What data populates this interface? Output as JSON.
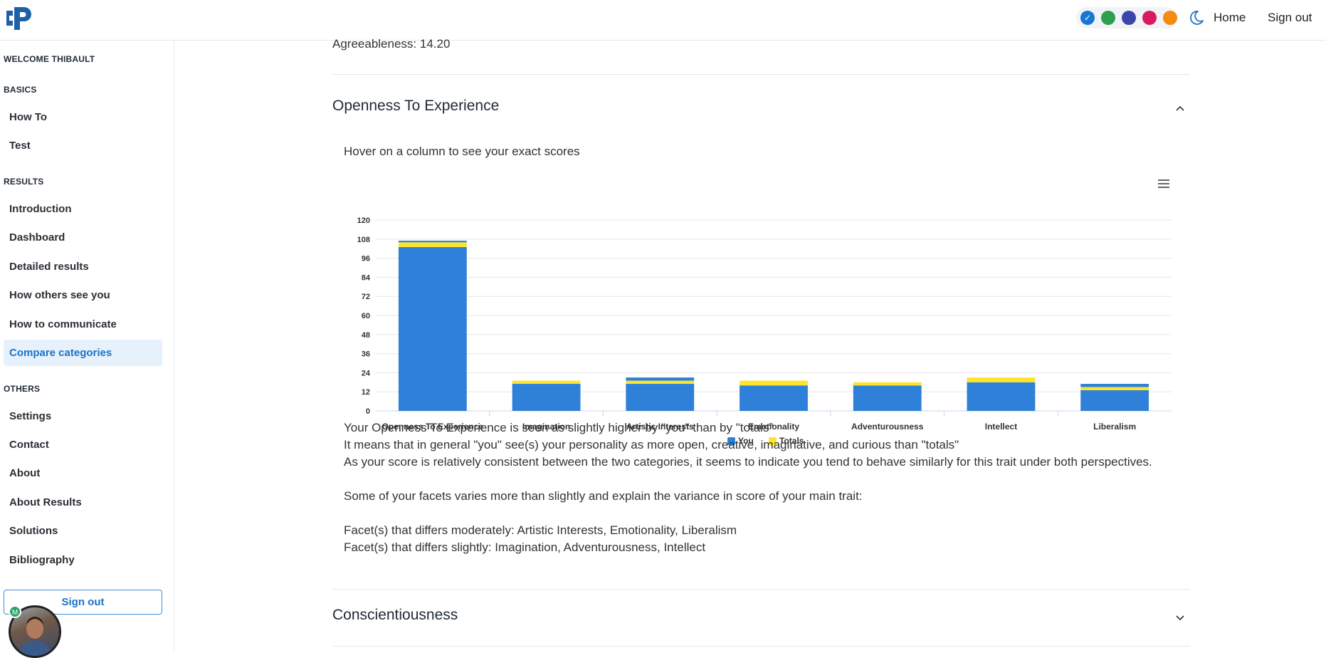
{
  "nav": {
    "home": "Home",
    "signout": "Sign out",
    "theme_colors": [
      "#1976d2",
      "#2e9e4f",
      "#3a46a8",
      "#d81b60",
      "#f58a12"
    ]
  },
  "sidebar": {
    "welcome": "WELCOME THIBAULT",
    "basics_header": "BASICS",
    "basics": [
      "How To",
      "Test"
    ],
    "results_header": "RESULTS",
    "results": [
      "Introduction",
      "Dashboard",
      "Detailed results",
      "How others see you",
      "How to communicate",
      "Compare categories"
    ],
    "others_header": "OTHERS",
    "others": [
      "Settings",
      "Contact",
      "About",
      "About Results",
      "Solutions",
      "Bibliography"
    ],
    "signout": "Sign out",
    "avatar_badge": "M"
  },
  "main": {
    "agreeableness_line": "Agreeableness: 14.20",
    "openness_title": "Openness To Experience",
    "hover_note": "Hover on a column to see your exact scores",
    "desc": {
      "line1": "Your Openness To Experience is seen as slightly higher by \"you\" than by \"totals\"",
      "line2": "It means that in general \"you\" see(s) your personality as more open, creative, imaginative, and curious than \"totals\"",
      "line3": "As your score is relatively consistent between the two categories, it seems to indicate you tend to behave similarly for this trait under both perspectives.",
      "line4": "Some of your facets varies more than slightly and explain the variance in score of your main trait:",
      "line5": "Facet(s) that differs moderately: Artistic Interests, Emotionality, Liberalism",
      "line6": "Facet(s) that differs slightly: Imagination, Adventurousness, Intellect"
    },
    "conscientiousness_title": "Conscientiousness"
  },
  "chart_data": {
    "type": "bar",
    "stacked": true,
    "categories": [
      "Openness To Experience",
      "Imagination",
      "Artistic Interests",
      "Emotionality",
      "Adventurousness",
      "Intellect",
      "Liberalism"
    ],
    "series": [
      {
        "name": "You",
        "color": "#2f80d8",
        "values": [
          103,
          17,
          17,
          16,
          16,
          18,
          13
        ]
      },
      {
        "name": "Totals",
        "color": "#ffe42b",
        "values": [
          3,
          2,
          2,
          3,
          2,
          3,
          2
        ]
      },
      {
        "name": "",
        "color": "#2f80d8",
        "values": [
          1,
          0,
          2,
          0,
          0,
          0,
          2
        ]
      }
    ],
    "yticks": [
      0,
      12,
      24,
      36,
      48,
      60,
      72,
      84,
      96,
      108,
      120
    ],
    "ylim": [
      0,
      120
    ],
    "grid": true,
    "legend_position": "bottom-center",
    "legend": [
      "You",
      "Totals"
    ]
  }
}
